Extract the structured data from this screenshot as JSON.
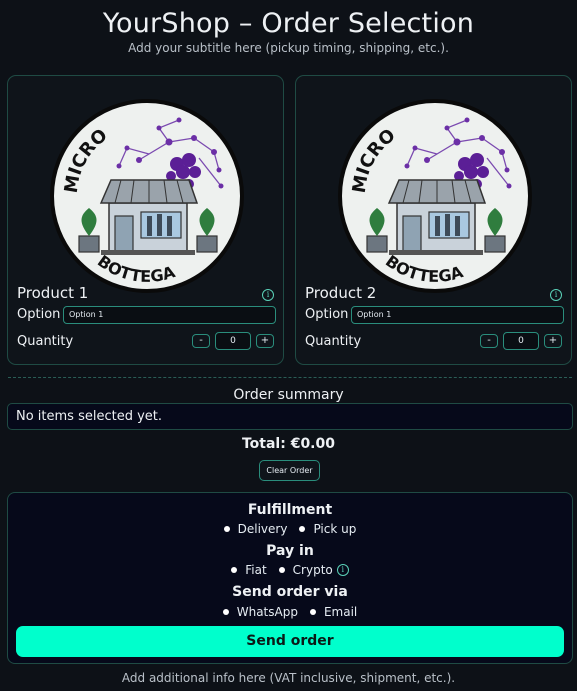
{
  "header": {
    "title": "YourShop – Order Selection",
    "subtitle": "Add your subtitle here (pickup timing, shipping, etc.)."
  },
  "products": [
    {
      "name": "Product 1",
      "logo_text_top": "MICRO",
      "logo_text_bottom": "BOTTEGA",
      "option_label": "Option",
      "option_value": "Option 1",
      "quantity_label": "Quantity",
      "quantity": "0",
      "minus": "-",
      "plus": "+",
      "info": "i"
    },
    {
      "name": "Product 2",
      "logo_text_top": "MICRO",
      "logo_text_bottom": "BOTTEGA",
      "option_label": "Option",
      "option_value": "Option 1",
      "quantity_label": "Quantity",
      "quantity": "0",
      "minus": "-",
      "plus": "+",
      "info": "i"
    }
  ],
  "summary": {
    "title": "Order summary",
    "empty_text": "No items selected yet.",
    "total": "Total: €0.00",
    "clear_label": "Clear Order"
  },
  "fulfillment": {
    "title": "Fulfillment",
    "options": [
      "Delivery",
      "Pick up"
    ]
  },
  "pay": {
    "title": "Pay in",
    "options": [
      "Fiat",
      "Crypto"
    ],
    "info": "i"
  },
  "send_via": {
    "title": "Send order via",
    "options": [
      "WhatsApp",
      "Email"
    ]
  },
  "send_button": "Send order",
  "footer": "Add additional info here (VAT inclusive, shipment, etc.).",
  "colors": {
    "accent": "#00ffcc",
    "background": "#0d1117",
    "border": "#1f4b44"
  }
}
